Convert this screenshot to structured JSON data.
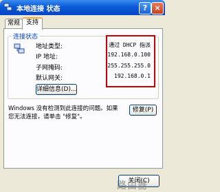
{
  "window": {
    "title": "本地连接 状态",
    "help_label": "?",
    "close_label": "×"
  },
  "tabs": [
    {
      "label": "常规"
    },
    {
      "label": "支持"
    }
  ],
  "connection_status": {
    "group_label": "连接状态",
    "rows": [
      {
        "label": "地址类型:",
        "value": "通过 DHCP 指派"
      },
      {
        "label": "IP 地址:",
        "value": "192.168.0.100"
      },
      {
        "label": "子网掩码:",
        "value": "255.255.255.0"
      },
      {
        "label": "默认网关:",
        "value": "192.168.0.1"
      }
    ],
    "details_button": "详细信息(D)...",
    "highlight_color": "#c40000"
  },
  "diagnostic": {
    "line1": "Windows 没有检测到此连接的问题。如果",
    "line2": "您无法连接，请单击 \"修复\"。",
    "repair_button": "修复(P)"
  },
  "footer": {
    "close_button": "关闭(C)"
  },
  "watermark": "路由器"
}
